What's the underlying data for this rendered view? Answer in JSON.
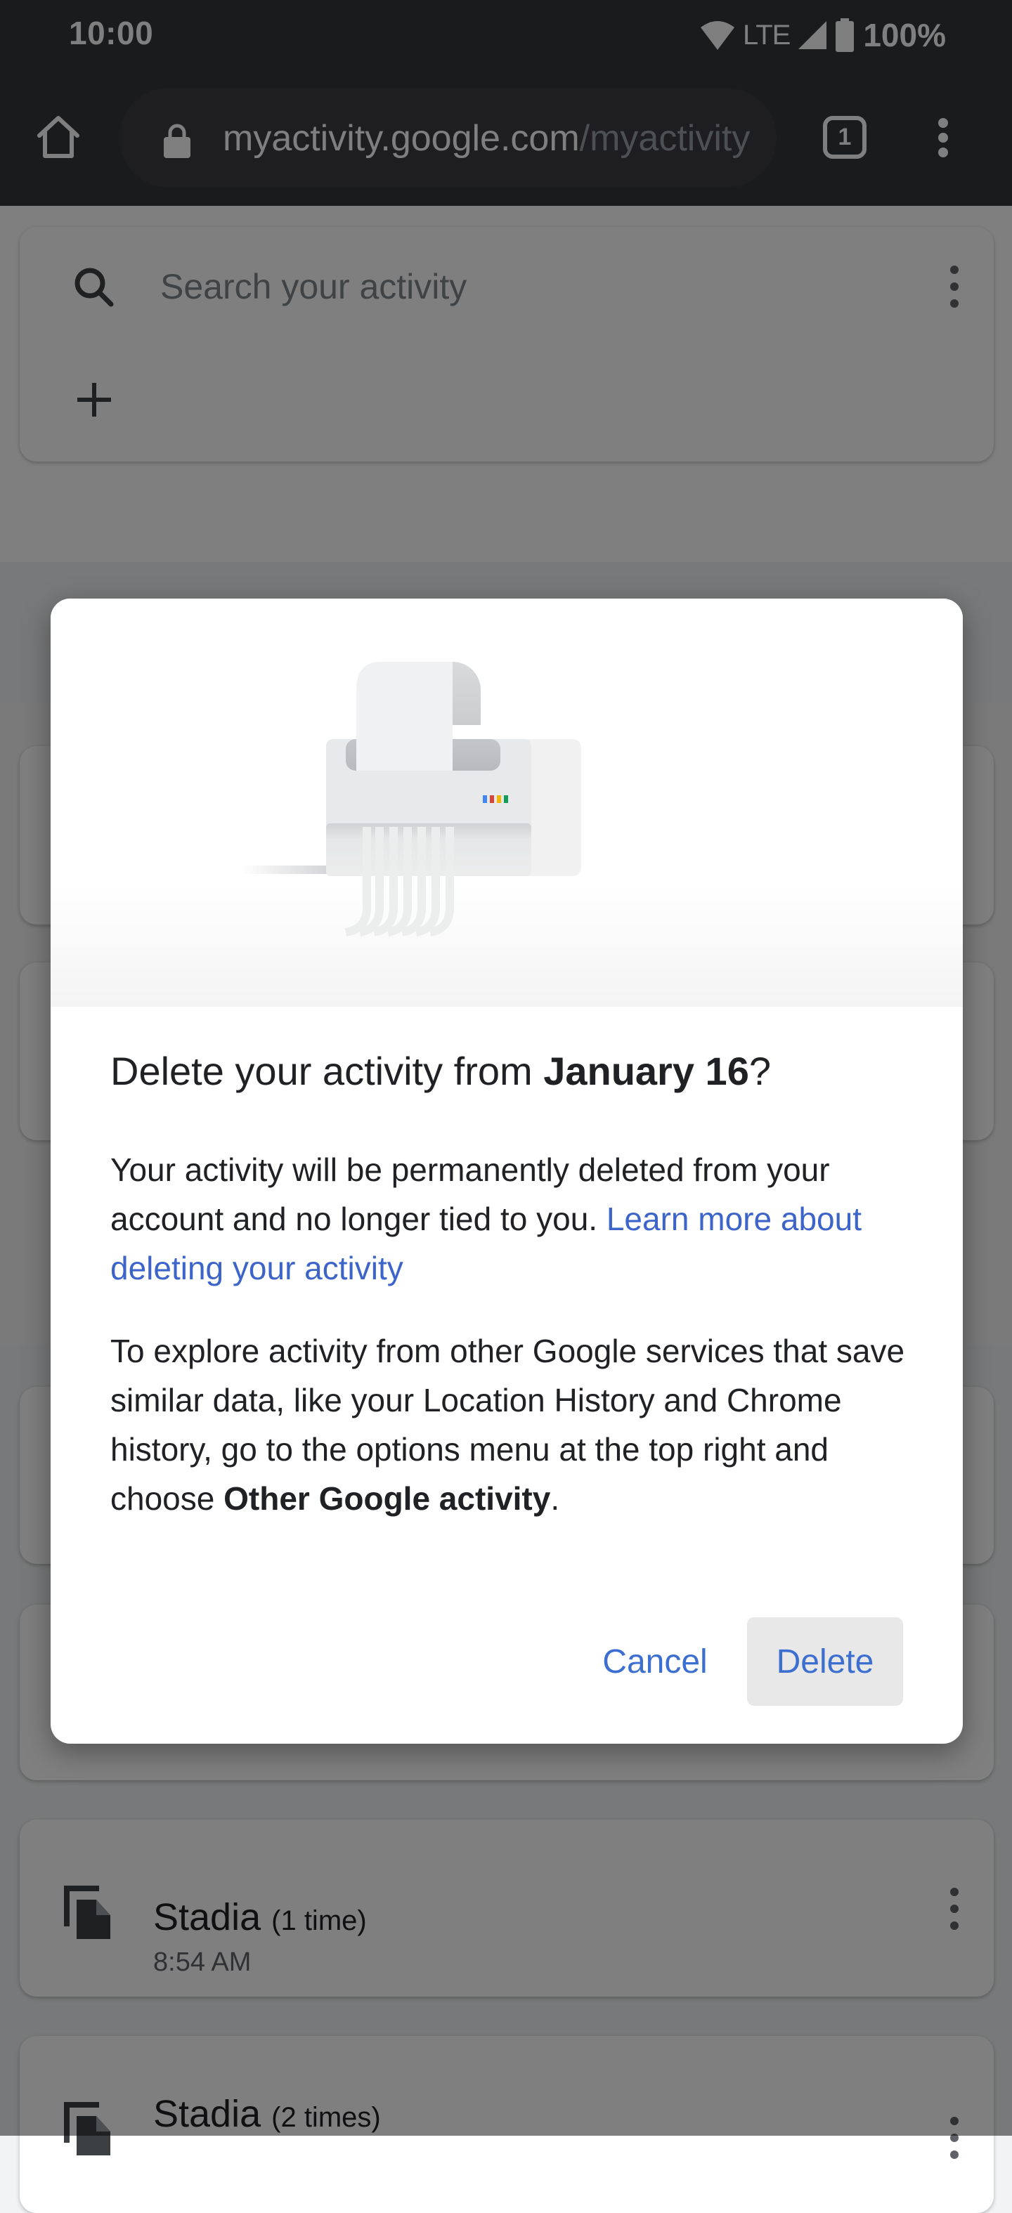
{
  "status_bar": {
    "time": "10:00",
    "network": "LTE",
    "battery": "100%",
    "icons": [
      "wifi-icon",
      "cell-signal-icon",
      "battery-icon"
    ]
  },
  "browser": {
    "url_host": "myactivity.google.com",
    "url_path": "/myactivity",
    "tab_count": "1",
    "icons": [
      "home-icon",
      "lock-icon",
      "tab-switcher-icon",
      "more-vert-icon"
    ]
  },
  "search": {
    "placeholder": "Search your activity",
    "icons": [
      "search-icon",
      "more-vert-icon",
      "plus-icon"
    ]
  },
  "activity_items": [
    {
      "title": "Stadia",
      "count": "(1 time)",
      "time": "8:54 AM",
      "icon": "file-copy-icon"
    },
    {
      "title": "Stadia",
      "count": "(2 times)",
      "time": "",
      "icon": "file-copy-icon"
    }
  ],
  "dialog": {
    "title_prefix": "Delete your activity from ",
    "title_date": "January 16",
    "title_suffix": "?",
    "body1_text": "Your activity will be permanently deleted from your account and no longer tied to you. ",
    "body1_link": "Learn more about deleting your activity",
    "body2_prefix": "To explore activity from other Google services that save similar data, like your Location History and Chrome history, go to the options menu at the top right and choose ",
    "body2_bold": "Other Google activity",
    "body2_suffix": ".",
    "cancel_label": "Cancel",
    "delete_label": "Delete",
    "illustration": "paper-shredder-illustration"
  },
  "colors": {
    "accent_blue": "#3c6fd0",
    "link_blue": "#3c64c9",
    "chrome_bg": "#35363a",
    "google_dots": [
      "#4285f4",
      "#db4437",
      "#f4b400",
      "#0f9d58"
    ]
  }
}
